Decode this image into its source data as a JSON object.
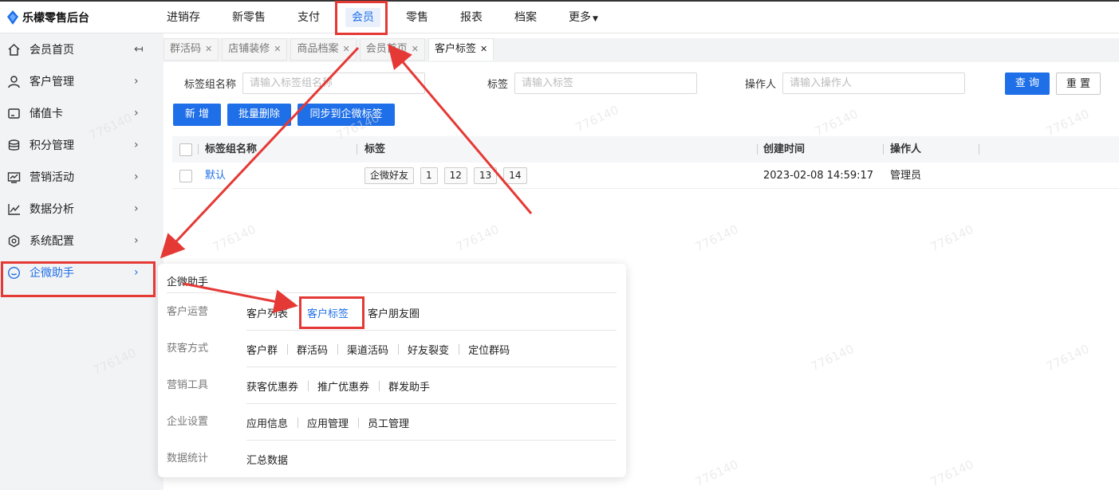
{
  "app": {
    "title": "乐檬零售后台"
  },
  "topnav": {
    "items": [
      {
        "label": "进销存"
      },
      {
        "label": "新零售"
      },
      {
        "label": "支付"
      },
      {
        "label": "会员",
        "active": true
      },
      {
        "label": "零售"
      },
      {
        "label": "报表"
      },
      {
        "label": "档案"
      },
      {
        "label": "更多"
      }
    ]
  },
  "sidebar": {
    "items": [
      {
        "label": "会员首页",
        "icon": "home-icon"
      },
      {
        "label": "客户管理",
        "icon": "user-icon"
      },
      {
        "label": "储值卡",
        "icon": "card-icon"
      },
      {
        "label": "积分管理",
        "icon": "coins-icon"
      },
      {
        "label": "营销活动",
        "icon": "monitor-icon"
      },
      {
        "label": "数据分析",
        "icon": "chart-icon"
      },
      {
        "label": "系统配置",
        "icon": "settings-icon"
      },
      {
        "label": "企微助手",
        "icon": "chat-icon"
      }
    ]
  },
  "tabs": [
    {
      "label": "群活码"
    },
    {
      "label": "店铺装修"
    },
    {
      "label": "商品档案"
    },
    {
      "label": "会员首页"
    },
    {
      "label": "客户标签",
      "active": true
    }
  ],
  "filters": {
    "group_label": "标签组名称",
    "group_placeholder": "请输入标签组名称",
    "tag_label": "标签",
    "tag_placeholder": "请输入标签",
    "operator_label": "操作人",
    "operator_placeholder": "请输入操作人"
  },
  "buttons": {
    "query": "查 询",
    "reset": "重 置",
    "add": "新 增",
    "batch_delete": "批量删除",
    "sync": "同步到企微标签"
  },
  "table": {
    "columns": [
      "标签组名称",
      "标签",
      "创建时间",
      "操作人"
    ],
    "rows": [
      {
        "group": "默认",
        "tags": [
          "企微好友",
          "1",
          "12",
          "13",
          "14"
        ],
        "created": "2023-02-08 14:59:17",
        "operator": "管理员"
      }
    ]
  },
  "popup": {
    "title": "企微助手",
    "sections": [
      {
        "category": "客户运营",
        "links": [
          "客户列表",
          "客户标签",
          "客户朋友圈"
        ],
        "active": "客户标签"
      },
      {
        "category": "获客方式",
        "links": [
          "客户群",
          "群活码",
          "渠道活码",
          "好友裂变",
          "定位群码"
        ]
      },
      {
        "category": "营销工具",
        "links": [
          "获客优惠券",
          "推广优惠券",
          "群发助手"
        ]
      },
      {
        "category": "企业设置",
        "links": [
          "应用信息",
          "应用管理",
          "员工管理"
        ]
      },
      {
        "category": "数据统计",
        "links": [
          "汇总数据"
        ]
      }
    ]
  },
  "watermark": "776140",
  "colors": {
    "accent": "#1e6fe8",
    "annotation": "#e53935"
  }
}
